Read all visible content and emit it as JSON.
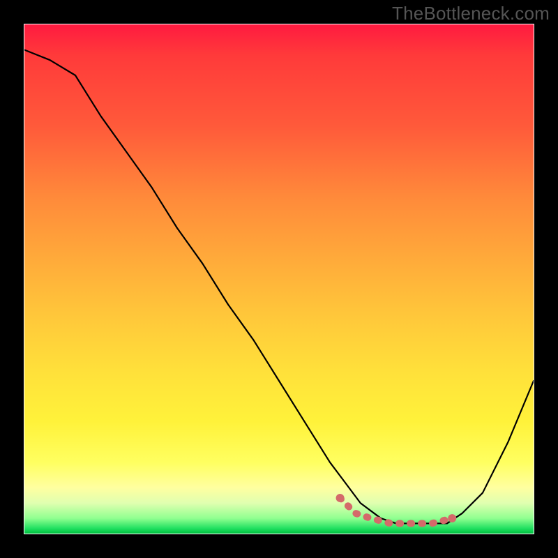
{
  "watermark": "TheBottleneck.com",
  "chart_data": {
    "type": "line",
    "title": "",
    "xlabel": "",
    "ylabel": "",
    "xlim": [
      0,
      100
    ],
    "ylim": [
      0,
      100
    ],
    "gradient_bands": [
      {
        "color": "#ff1a40",
        "stop": 0
      },
      {
        "color": "#ff3a3a",
        "stop": 6
      },
      {
        "color": "#ff5a3a",
        "stop": 20
      },
      {
        "color": "#ff8a3a",
        "stop": 34
      },
      {
        "color": "#ffaa3a",
        "stop": 46
      },
      {
        "color": "#ffc93a",
        "stop": 58
      },
      {
        "color": "#ffe03a",
        "stop": 68
      },
      {
        "color": "#fff23a",
        "stop": 78
      },
      {
        "color": "#ffff60",
        "stop": 86
      },
      {
        "color": "#ffffa0",
        "stop": 91
      },
      {
        "color": "#e0ffb0",
        "stop": 94
      },
      {
        "color": "#90ff90",
        "stop": 97
      },
      {
        "color": "#20e060",
        "stop": 99
      },
      {
        "color": "#00c040",
        "stop": 100
      }
    ],
    "series": [
      {
        "name": "bottleneck-curve",
        "color": "#000000",
        "x": [
          0,
          5,
          10,
          15,
          20,
          25,
          30,
          35,
          40,
          45,
          50,
          55,
          60,
          63,
          66,
          70,
          73,
          76,
          80,
          83,
          86,
          90,
          95,
          100
        ],
        "y": [
          95,
          93,
          90,
          82,
          75,
          68,
          60,
          53,
          45,
          38,
          30,
          22,
          14,
          10,
          6,
          3,
          2,
          2,
          2,
          2,
          4,
          8,
          18,
          30
        ]
      }
    ],
    "markers": {
      "name": "optimal-band",
      "color": "#d46a6a",
      "x": [
        62,
        65,
        68,
        72,
        76,
        80,
        84
      ],
      "y": [
        7,
        4,
        3,
        2,
        2,
        2,
        3
      ]
    }
  }
}
